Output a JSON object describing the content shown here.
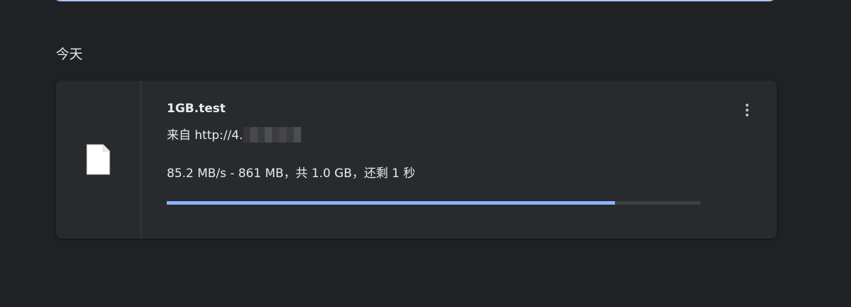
{
  "section": {
    "date_label": "今天"
  },
  "download": {
    "file_name": "1GB.test",
    "source_prefix": "来自 http://4.",
    "status": "85.2 MB/s - 861 MB，共 1.0 GB，还剩 1 秒",
    "progress_fraction": 0.84,
    "file_icon": "file-icon",
    "menu_icon": "more-vert-icon"
  },
  "colors": {
    "background": "#202124",
    "card": "#292a2d",
    "progress": "#8ab4f8",
    "track": "#3c4043",
    "search_border": "#a8c7fa"
  }
}
